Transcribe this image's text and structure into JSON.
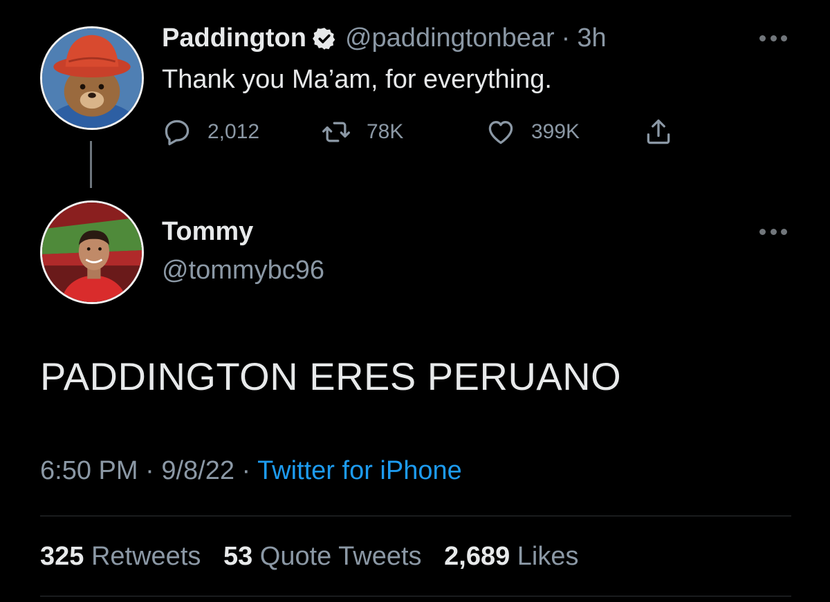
{
  "tweet1": {
    "name": "Paddington",
    "handle": "@paddingtonbear",
    "separator": "·",
    "time": "3h",
    "text": "Thank you Ma’am, for everything.",
    "actions": {
      "replies": "2,012",
      "retweets": "78K",
      "likes": "399K"
    }
  },
  "tweet2": {
    "name": "Tommy",
    "handle": "@tommybc96",
    "text": "PADDINGTON ERES PERUANO",
    "meta": {
      "time": "6:50 PM",
      "date": "9/8/22",
      "separator": "·",
      "source": "Twitter for iPhone"
    },
    "stats": {
      "retweets_count": "325",
      "retweets_label": "Retweets",
      "quotes_count": "53",
      "quotes_label": "Quote Tweets",
      "likes_count": "2,689",
      "likes_label": "Likes"
    }
  },
  "icons": {
    "verified": "verified-badge-icon",
    "reply": "reply-icon",
    "retweet": "retweet-icon",
    "like": "heart-icon",
    "share": "share-icon",
    "more": "more-icon"
  },
  "colors": {
    "background": "#000000",
    "text_primary": "#e7e9ea",
    "text_secondary": "#8b98a5",
    "link": "#1d9bf0",
    "divider": "#2f3336"
  }
}
